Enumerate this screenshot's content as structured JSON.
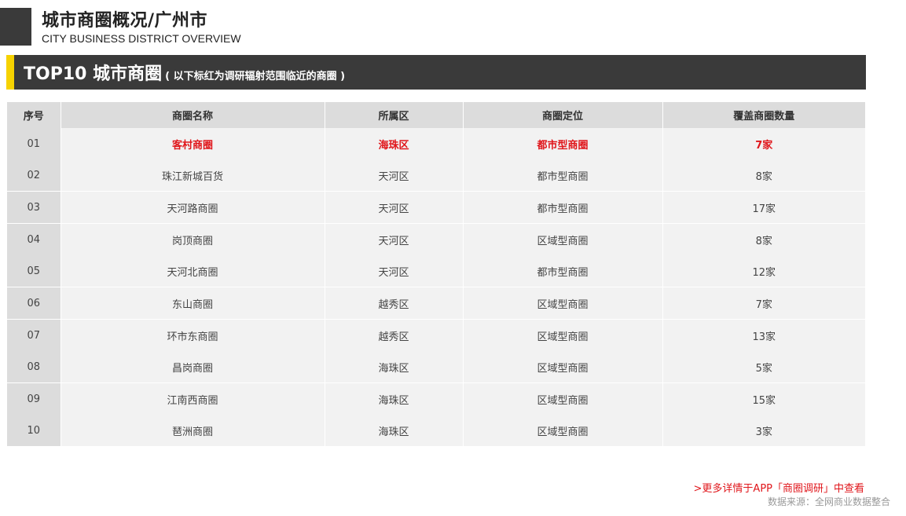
{
  "header": {
    "title": "城市商圈概况/广州市",
    "subtitle": "CITY BUSINESS DISTRICT OVERVIEW"
  },
  "section": {
    "title": "TOP10 城市商圈",
    "note": "( 以下标红为调研辐射范围临近的商圈 )"
  },
  "colors": {
    "accent_yellow": "#f6d200",
    "bar_dark": "#3a3a3a",
    "highlight_red": "#e0161b"
  },
  "table": {
    "headers": [
      "序号",
      "商圈名称",
      "所属区",
      "商圈定位",
      "覆盖商圈数量"
    ],
    "rows": [
      {
        "no": "01",
        "name": "客村商圈",
        "district": "海珠区",
        "type": "都市型商圈",
        "count": "7家"
      },
      {
        "no": "02",
        "name": "珠江新城百货",
        "district": "天河区",
        "type": "都市型商圈",
        "count": "8家"
      },
      {
        "no": "03",
        "name": "天河路商圈",
        "district": "天河区",
        "type": "都市型商圈",
        "count": "17家"
      },
      {
        "no": "04",
        "name": "岗顶商圈",
        "district": "天河区",
        "type": "区域型商圈",
        "count": "8家"
      },
      {
        "no": "05",
        "name": "天河北商圈",
        "district": "天河区",
        "type": "都市型商圈",
        "count": "12家"
      },
      {
        "no": "06",
        "name": "东山商圈",
        "district": "越秀区",
        "type": "区域型商圈",
        "count": "7家"
      },
      {
        "no": "07",
        "name": "环市东商圈",
        "district": "越秀区",
        "type": "区域型商圈",
        "count": "13家"
      },
      {
        "no": "08",
        "name": "昌岗商圈",
        "district": "海珠区",
        "type": "区域型商圈",
        "count": "5家"
      },
      {
        "no": "09",
        "name": "江南西商圈",
        "district": "海珠区",
        "type": "区域型商圈",
        "count": "15家"
      },
      {
        "no": "10",
        "name": "琶洲商圈",
        "district": "海珠区",
        "type": "区域型商圈",
        "count": "3家"
      }
    ]
  },
  "footer": {
    "link": ">更多详情于APP「商圈调研」中查看",
    "source": "数据来源：全网商业数据整合"
  }
}
